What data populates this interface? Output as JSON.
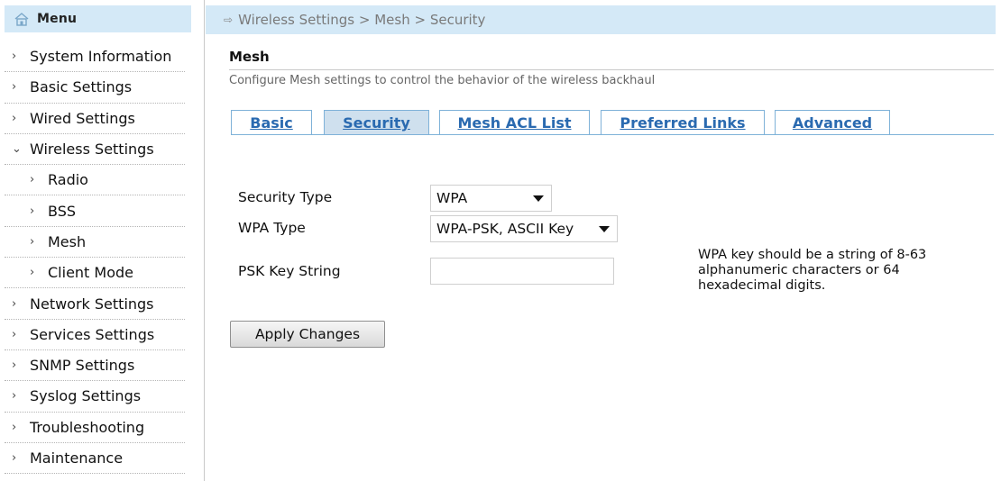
{
  "menu": {
    "title": "Menu",
    "items": [
      {
        "label": "System Information",
        "chevron": "›",
        "sub": false
      },
      {
        "label": "Basic Settings",
        "chevron": "›",
        "sub": false
      },
      {
        "label": "Wired Settings",
        "chevron": "›",
        "sub": false
      },
      {
        "label": "Wireless Settings",
        "chevron": "⌄",
        "sub": false
      },
      {
        "label": "Radio",
        "chevron": "›",
        "sub": true
      },
      {
        "label": "BSS",
        "chevron": "›",
        "sub": true
      },
      {
        "label": "Mesh",
        "chevron": "›",
        "sub": true
      },
      {
        "label": "Client Mode",
        "chevron": "›",
        "sub": true
      },
      {
        "label": "Network Settings",
        "chevron": "›",
        "sub": false
      },
      {
        "label": "Services Settings",
        "chevron": "›",
        "sub": false
      },
      {
        "label": "SNMP Settings",
        "chevron": "›",
        "sub": false
      },
      {
        "label": "Syslog Settings",
        "chevron": "›",
        "sub": false
      },
      {
        "label": "Troubleshooting",
        "chevron": "›",
        "sub": false
      },
      {
        "label": "Maintenance",
        "chevron": "›",
        "sub": false
      }
    ]
  },
  "breadcrumb": {
    "arrow": "⇨",
    "text": "Wireless Settings > Mesh > Security"
  },
  "section": {
    "title": "Mesh",
    "description": "Configure Mesh settings to control the behavior of the wireless backhaul"
  },
  "tabs": [
    {
      "label": "Basic",
      "active": false
    },
    {
      "label": "Security",
      "active": true
    },
    {
      "label": "Mesh ACL List",
      "active": false
    },
    {
      "label": "Preferred Links",
      "active": false
    },
    {
      "label": "Advanced",
      "active": false
    }
  ],
  "form": {
    "security_type_label": "Security Type",
    "security_type_value": "WPA",
    "wpa_type_label": "WPA Type",
    "wpa_type_value": "WPA-PSK, ASCII Key",
    "psk_label": "PSK Key String",
    "psk_value": "",
    "help_text": "WPA key should be a string of 8-63 alphanumeric characters or 64 hexadecimal digits.",
    "apply_label": "Apply Changes"
  },
  "colors": {
    "header_bg": "#d4e9f7",
    "tab_text": "#2a6ab0",
    "tab_active_bg": "#cfe0ee",
    "tab_border": "#7fb2d8"
  }
}
